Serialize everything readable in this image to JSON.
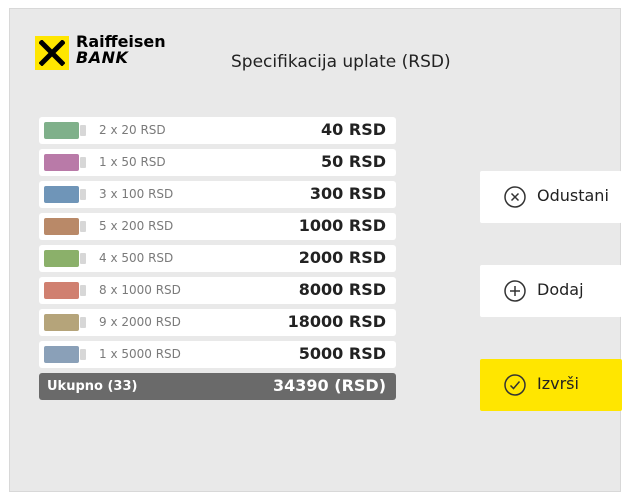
{
  "header": {
    "logo_line1": "Raiffeisen",
    "logo_line2": "BANK",
    "title": "Specifikacija uplate (RSD)"
  },
  "denominations": [
    {
      "qty": "2 x 20 RSD",
      "amount": "40 RSD",
      "color": "#7fb08a"
    },
    {
      "qty": "1 x 50 RSD",
      "amount": "50 RSD",
      "color": "#b97aa8"
    },
    {
      "qty": "3 x 100 RSD",
      "amount": "300 RSD",
      "color": "#6f95b8"
    },
    {
      "qty": "5 x 200 RSD",
      "amount": "1000 RSD",
      "color": "#b98968"
    },
    {
      "qty": "4 x 500 RSD",
      "amount": "2000 RSD",
      "color": "#8bb06a"
    },
    {
      "qty": "8 x 1000 RSD",
      "amount": "8000 RSD",
      "color": "#d08070"
    },
    {
      "qty": "9 x 2000 RSD",
      "amount": "18000 RSD",
      "color": "#b5a47a"
    },
    {
      "qty": "1 x 5000 RSD",
      "amount": "5000 RSD",
      "color": "#8aa0b8"
    }
  ],
  "total": {
    "label": "Ukupno (33)",
    "value": "34390 (RSD)"
  },
  "buttons": {
    "cancel": "Odustani",
    "add": "Dodaj",
    "execute": "Izvrši"
  },
  "colors": {
    "accent": "#ffe600",
    "background": "#e9e9e9",
    "total_bar": "#6a6a6a"
  },
  "icons": {
    "cancel": "x-circle-icon",
    "add": "plus-circle-icon",
    "execute": "check-circle-icon"
  }
}
